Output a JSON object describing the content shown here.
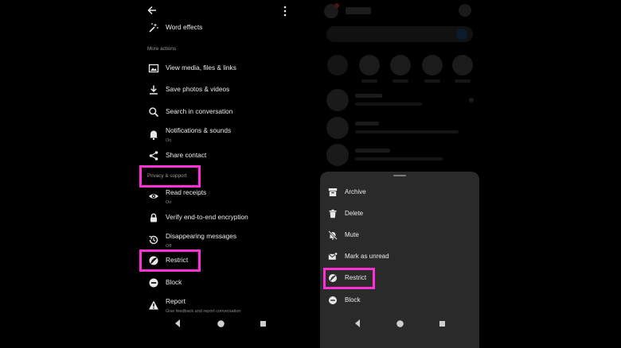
{
  "left_screen": {
    "word_effects": "Word effects",
    "more_actions_header": "More actions",
    "view_media": "View media, files & links",
    "save_photos": "Save photos & videos",
    "search_conversation": "Search in conversation",
    "notifications": "Notifications & sounds",
    "notifications_status": "On",
    "share_contact": "Share contact",
    "privacy_header": "Privacy & support",
    "read_receipts": "Read receipts",
    "read_receipts_status": "On",
    "verify_encryption": "Verify end-to-end encryption",
    "disappearing": "Disappearing messages",
    "disappearing_status": "Off",
    "restrict": "Restrict",
    "block": "Block",
    "report": "Report",
    "report_sub": "Give feedback and report conversation"
  },
  "right_screen": {
    "sheet_items": [
      {
        "label": "Archive",
        "icon": "archive-icon"
      },
      {
        "label": "Delete",
        "icon": "trash-icon"
      },
      {
        "label": "Mute",
        "icon": "bell-off-icon"
      },
      {
        "label": "Mark as unread",
        "icon": "mail-unread-icon"
      },
      {
        "label": "Restrict",
        "icon": "restrict-icon"
      },
      {
        "label": "Block",
        "icon": "block-icon"
      }
    ]
  },
  "highlight_color": "#ff2fd6"
}
